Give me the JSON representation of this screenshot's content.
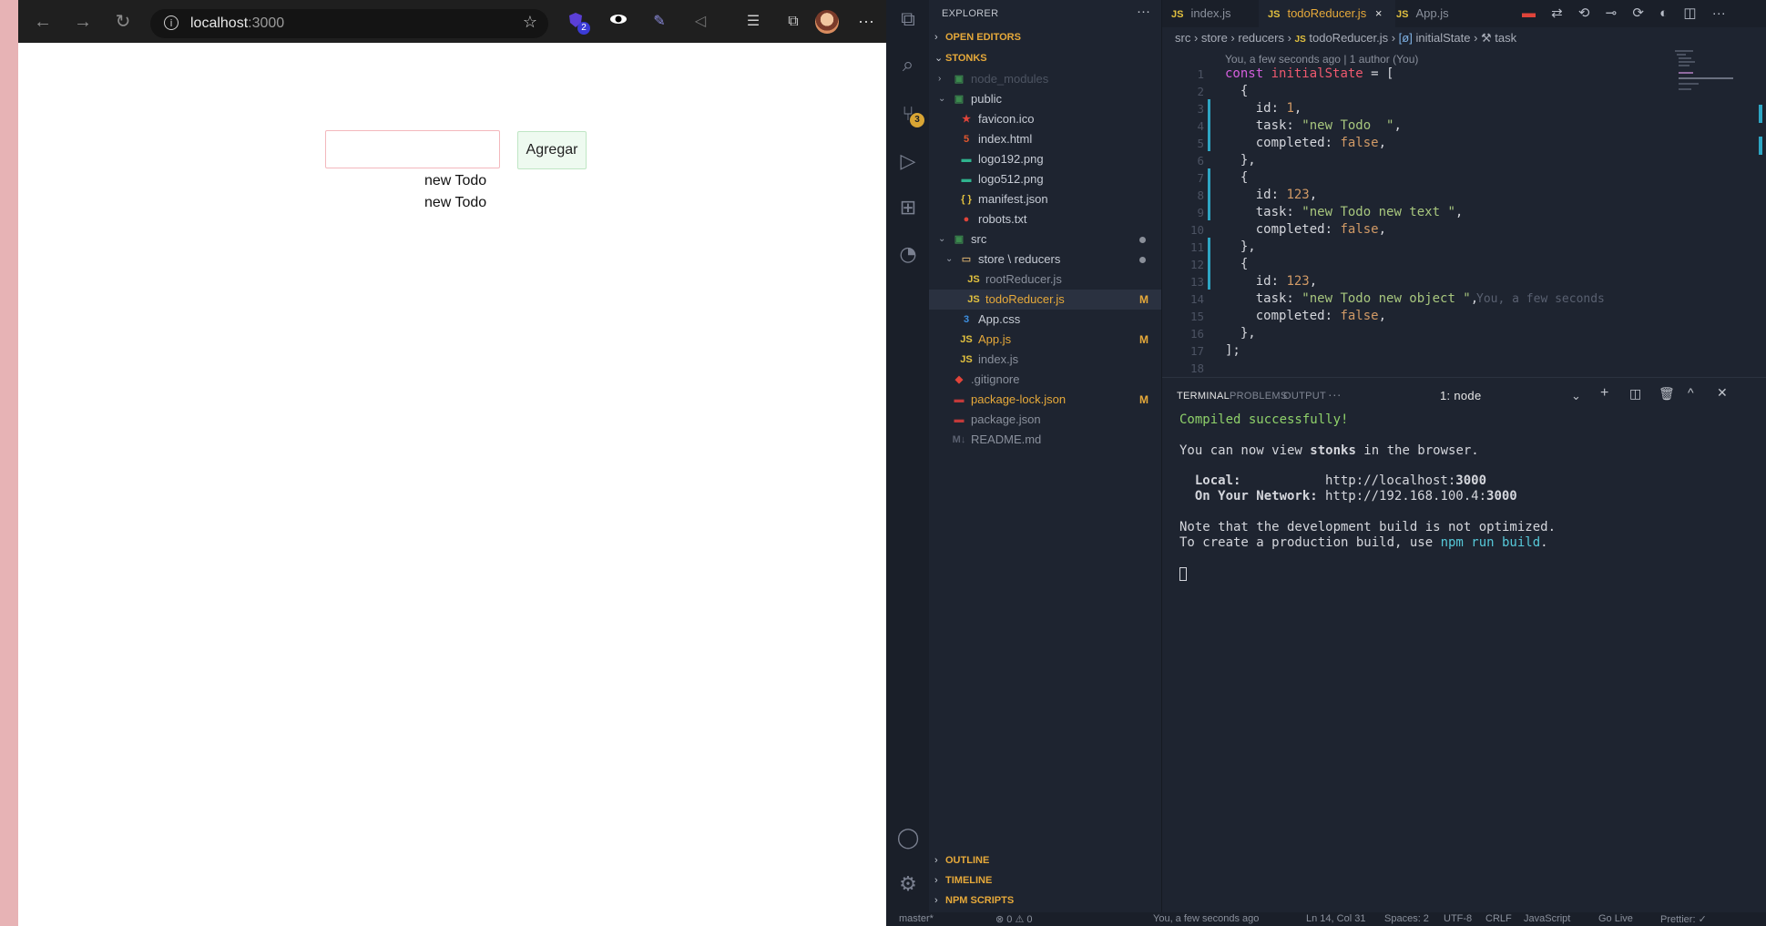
{
  "browser": {
    "url": "localhost",
    "port": ":3000",
    "extension_badge": "2",
    "input_value": "",
    "add_button": "Agregar",
    "todos": [
      "new Todo",
      "new Todo"
    ]
  },
  "vscode": {
    "explorer_title": "EXPLORER",
    "sections": {
      "open_editors": "OPEN EDITORS",
      "project": "STONKS",
      "outline": "OUTLINE",
      "timeline": "TIMELINE",
      "npm_scripts": "NPM SCRIPTS"
    },
    "scm_badge": "3",
    "tree": [
      {
        "label": "node_modules",
        "icon": "folder-node-icon",
        "glyph": "▣",
        "color": "#4d5462",
        "iconColor": "#3c8a4e",
        "chev": "›",
        "indent": 0,
        "status": ""
      },
      {
        "label": "public",
        "icon": "folder-public-icon",
        "glyph": "▣",
        "color": "#c7ccd5",
        "iconColor": "#3c8a4e",
        "chev": "⌄",
        "indent": 0,
        "status": ""
      },
      {
        "label": "favicon.ico",
        "icon": "star-icon",
        "glyph": "★",
        "color": "#c7ccd5",
        "iconColor": "#e0443a",
        "chev": "",
        "indent": 1,
        "status": ""
      },
      {
        "label": "index.html",
        "icon": "html-icon",
        "glyph": "5",
        "color": "#c7ccd5",
        "iconColor": "#e4572e",
        "chev": "",
        "indent": 1,
        "status": ""
      },
      {
        "label": "logo192.png",
        "icon": "image-icon",
        "glyph": "▬",
        "color": "#c7ccd5",
        "iconColor": "#2fb38e",
        "chev": "",
        "indent": 1,
        "status": ""
      },
      {
        "label": "logo512.png",
        "icon": "image-icon",
        "glyph": "▬",
        "color": "#c7ccd5",
        "iconColor": "#2fb38e",
        "chev": "",
        "indent": 1,
        "status": ""
      },
      {
        "label": "manifest.json",
        "icon": "json-icon",
        "glyph": "{ }",
        "color": "#c7ccd5",
        "iconColor": "#e2c13f",
        "chev": "",
        "indent": 1,
        "status": ""
      },
      {
        "label": "robots.txt",
        "icon": "robot-icon",
        "glyph": "●",
        "color": "#c7ccd5",
        "iconColor": "#e0443a",
        "chev": "",
        "indent": 1,
        "status": ""
      },
      {
        "label": "src",
        "icon": "folder-src-icon",
        "glyph": "▣",
        "color": "#c7ccd5",
        "iconColor": "#3c8a4e",
        "chev": "⌄",
        "indent": 0,
        "status": "dot"
      },
      {
        "label": "store \\ reducers",
        "icon": "folder-icon",
        "glyph": "▭",
        "color": "#c7ccd5",
        "iconColor": "#c9a46a",
        "chev": "⌄",
        "indent": 1,
        "status": "dot"
      },
      {
        "label": "rootReducer.js",
        "icon": "js-icon",
        "glyph": "JS",
        "color": "#8a909c",
        "iconColor": "#e2c13f",
        "chev": "",
        "indent": 2,
        "status": ""
      },
      {
        "label": "todoReducer.js",
        "icon": "js-icon",
        "glyph": "JS",
        "color": "#e6a93a",
        "iconColor": "#e2c13f",
        "chev": "",
        "indent": 2,
        "status": "M",
        "active": true
      },
      {
        "label": "App.css",
        "icon": "css-icon",
        "glyph": "3",
        "color": "#c7ccd5",
        "iconColor": "#3d8fe0",
        "chev": "",
        "indent": 1,
        "status": ""
      },
      {
        "label": "App.js",
        "icon": "js-icon",
        "glyph": "JS",
        "color": "#e6a93a",
        "iconColor": "#e2c13f",
        "chev": "",
        "indent": 1,
        "status": "M"
      },
      {
        "label": "index.js",
        "icon": "js-icon",
        "glyph": "JS",
        "color": "#8a909c",
        "iconColor": "#e2c13f",
        "chev": "",
        "indent": 1,
        "status": ""
      },
      {
        "label": ".gitignore",
        "icon": "git-icon",
        "glyph": "◆",
        "color": "#8a909c",
        "iconColor": "#e0443a",
        "chev": "",
        "indent": 0,
        "status": ""
      },
      {
        "label": "package-lock.json",
        "icon": "npm-icon",
        "glyph": "▬",
        "color": "#e6a93a",
        "iconColor": "#c23a3a",
        "chev": "",
        "indent": 0,
        "status": "M"
      },
      {
        "label": "package.json",
        "icon": "npm-icon",
        "glyph": "▬",
        "color": "#8a909c",
        "iconColor": "#c23a3a",
        "chev": "",
        "indent": 0,
        "status": ""
      },
      {
        "label": "README.md",
        "icon": "markdown-icon",
        "glyph": "M↓",
        "color": "#8a909c",
        "iconColor": "#5b6170",
        "chev": "",
        "indent": 0,
        "status": ""
      }
    ],
    "tabs": [
      {
        "label": "index.js",
        "active": false,
        "close": ""
      },
      {
        "label": "todoReducer.js",
        "active": true,
        "close": "×"
      },
      {
        "label": "App.js",
        "active": false,
        "close": ""
      }
    ],
    "breadcrumb": {
      "src": "src",
      "store": "store",
      "reducers": "reducers",
      "file": "todoReducer.js",
      "symbol1": "initialState",
      "symbol2": "task"
    },
    "blame_header": "You, a few seconds ago | 1 author (You)",
    "inline_blame": "You, a few seconds",
    "code_lines": [
      "const initialState = [",
      "  {",
      "    id: 1,",
      "    task: \"new Todo  \",",
      "    completed: false,",
      "  },",
      "  {",
      "    id: 123,",
      "    task: \"new Todo new text \",",
      "    completed: false,",
      "  },",
      "  {",
      "    id: 123,",
      "    task: \"new Todo new object \",",
      "    completed: false,",
      "  },",
      "];",
      ""
    ],
    "panel_tabs": {
      "terminal": "TERMINAL",
      "problems": "PROBLEMS",
      "output": "OUTPUT",
      "more": "···",
      "instance": "1: node"
    },
    "terminal": {
      "compiled": "Compiled successfully!",
      "view_pre": "You can now view ",
      "view_app": "stonks",
      "view_post": " in the browser.",
      "local_label": "  Local:",
      "local_url_pre": "http://localhost:",
      "local_port": "3000",
      "network_label": "  On Your Network:",
      "network_url_pre": "http://192.168.100.4:",
      "network_port": "3000",
      "note1": "Note that the development build is not optimized.",
      "note2_pre": "To create a production build, use ",
      "note2_cmd": "npm run build",
      "note2_post": "."
    },
    "statusbar": {
      "branch": "master*",
      "problems": "⊗ 0 ⚠ 0",
      "blame": "You, a few seconds ago",
      "position": "Ln 14, Col 31",
      "spaces": "Spaces: 2",
      "encoding": "UTF-8",
      "eol": "CRLF",
      "language": "JavaScript",
      "golive": "Go Live",
      "prettier": "Prettier: ✓"
    }
  }
}
